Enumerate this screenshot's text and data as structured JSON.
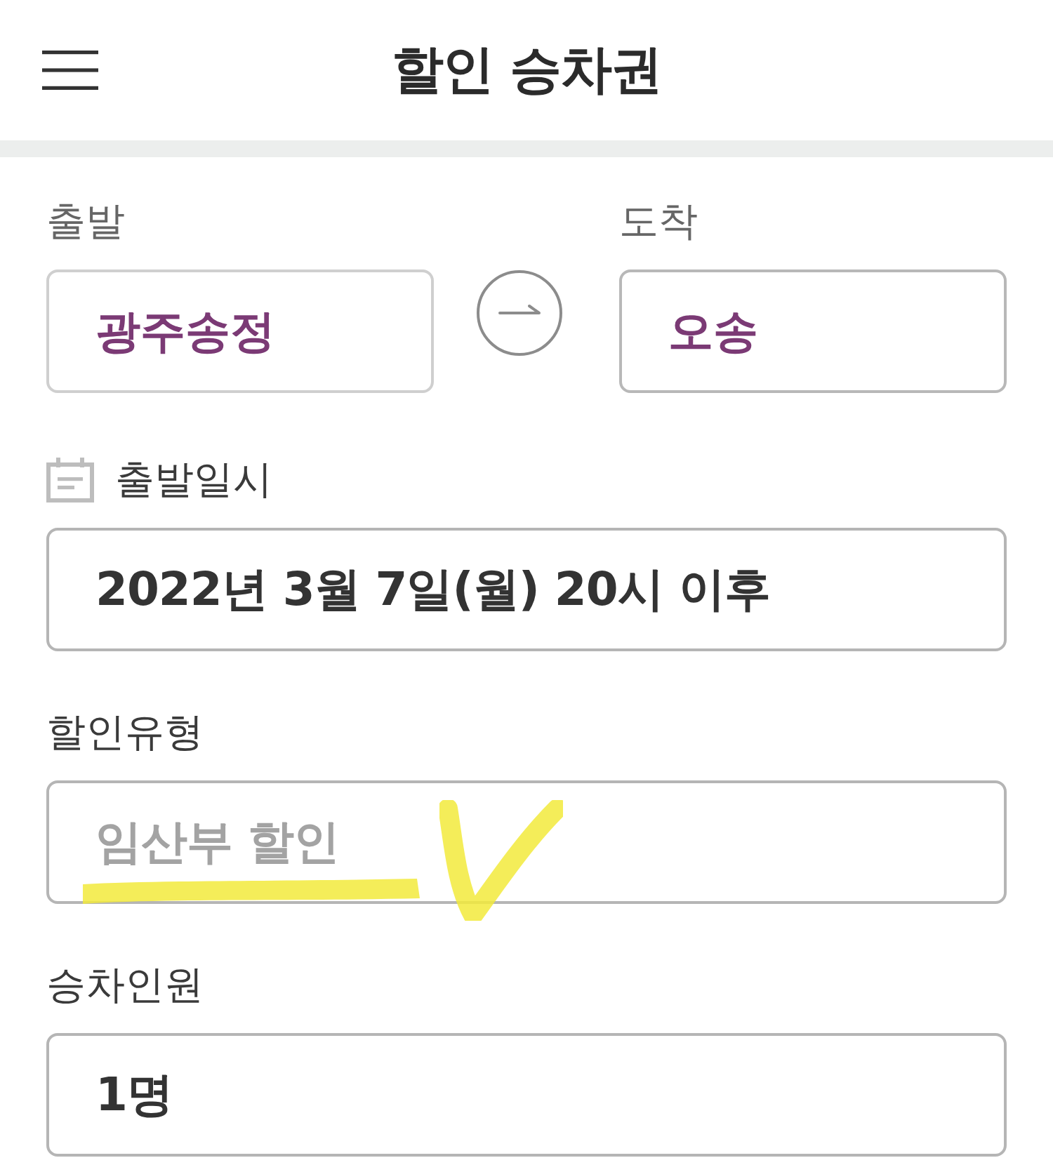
{
  "header": {
    "title": "할인 승차권"
  },
  "route": {
    "departure": {
      "label": "출발",
      "value": "광주송정"
    },
    "arrival": {
      "label": "도착",
      "value": "오송"
    }
  },
  "fields": [
    {
      "kind": "date",
      "label": "출발일시",
      "value": "2022년 3월 7일(월) 20시 이후",
      "disabled": false,
      "highlighted": false
    },
    {
      "kind": "discount",
      "label": "할인유형",
      "value": "임산부 할인",
      "disabled": true,
      "highlighted": true
    },
    {
      "kind": "passengers",
      "label": "승차인원",
      "value": "1명",
      "disabled": false,
      "highlighted": false
    }
  ]
}
